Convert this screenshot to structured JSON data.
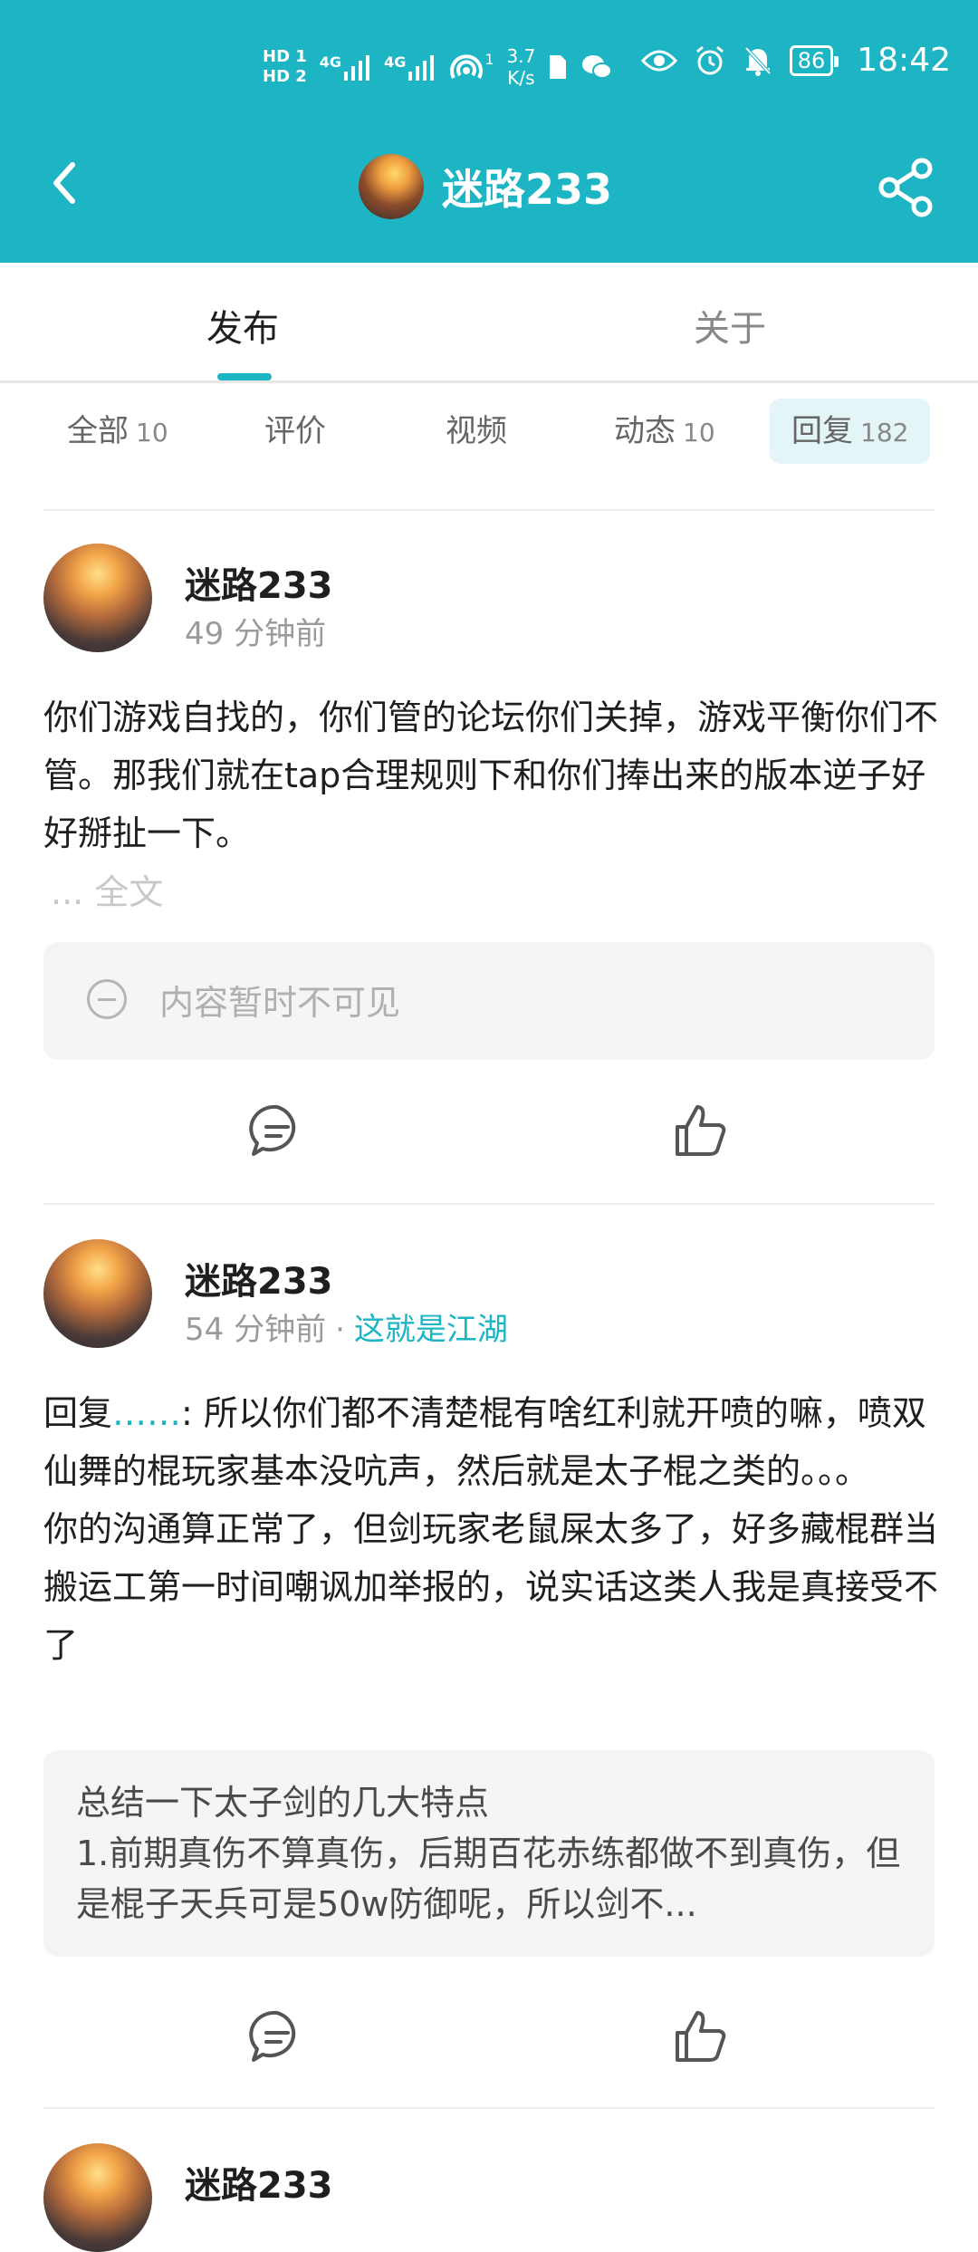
{
  "status_bar": {
    "sim1": "HD 1",
    "sim2": "HD 2",
    "net1": "4G",
    "net2": "4G",
    "hotspot_count": "1",
    "speed_value": "3.7",
    "speed_unit": "K/s",
    "battery": "86",
    "time": "18:42"
  },
  "top_nav": {
    "title": "迷路233"
  },
  "tabs": {
    "publish": "发布",
    "about": "关于"
  },
  "filters": [
    {
      "label": "全部",
      "count": "10"
    },
    {
      "label": "评价",
      "count": ""
    },
    {
      "label": "视频",
      "count": ""
    },
    {
      "label": "动态",
      "count": "10"
    },
    {
      "label": "回复",
      "count": "182"
    }
  ],
  "posts": [
    {
      "username": "迷路233",
      "time": "49 分钟前",
      "text": "你们游戏自找的，你们管的论坛你们关掉，游戏平衡你们不管。那我们就在tap合理规则下和你们捧出来的版本逆子好好掰扯一下。",
      "more": "... 全文",
      "hidden_notice": "内容暂时不可见"
    },
    {
      "username": "迷路233",
      "time": "54 分钟前",
      "dot": "·",
      "tag": "这就是江湖",
      "reply_prefix": "回复",
      "reply_dots": "……",
      "text": ": 所以你们都不清楚棍有啥红利就开喷的嘛，喷双仙舞的棍玩家基本没吭声，然后就是太子棍之类的。。。",
      "text2": "你的沟通算正常了，但剑玩家老鼠屎太多了，好多藏棍群当搬运工第一时间嘲讽加举报的，说实话这类人我是真接受不了",
      "quote_line1": "总结一下太子剑的几大特点",
      "quote_line2": "1.前期真伤不算真伤，后期百花赤练都做不到真伤，但是棍子天兵可是50w防御呢，所以剑不..."
    },
    {
      "username": "迷路233"
    }
  ],
  "colors": {
    "accent": "#1db5c4",
    "chip_active_bg": "#e3f5f7",
    "card_bg": "#f3f5f6"
  }
}
